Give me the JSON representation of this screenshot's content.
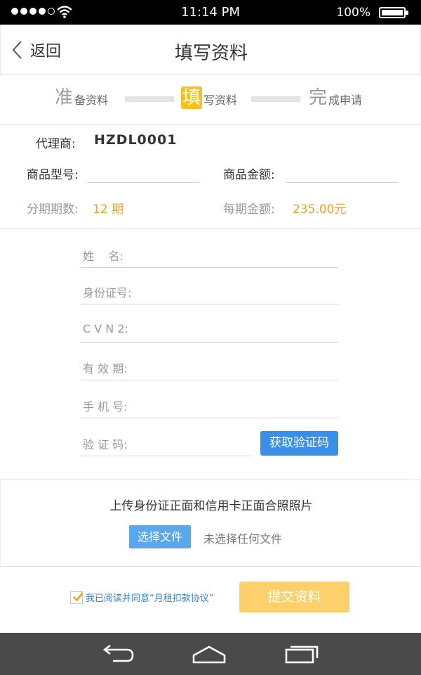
{
  "status_bar": {
    "time": "11:14 PM",
    "battery": "100%",
    "icons": [
      "signal-dots",
      "wifi-icon",
      "battery-icon"
    ]
  },
  "header": {
    "back_label": "返回",
    "title": "填写资料"
  },
  "steps": [
    {
      "big": "准",
      "small": "备资料",
      "active": false
    },
    {
      "big": "填",
      "small": "写资料",
      "active": true
    },
    {
      "big": "完",
      "small": "成申请",
      "active": false
    }
  ],
  "info": {
    "agent_label": "代理商:",
    "agent_value": "HZDL0001",
    "model_label": "商品型号:",
    "model_value": "",
    "amount_label": "商品金额:",
    "amount_value": "",
    "installments_label": "分期期数:",
    "installments_value": "12 期",
    "per_period_label": "每期金额:",
    "per_period_value": "235.00元"
  },
  "form": {
    "name_label": "姓    名:",
    "id_label": "身份证号:",
    "cvn_label": "C V N 2:",
    "expiry_label": "有 效 期:",
    "phone_label": "手 机 号:",
    "code_label": "验 证 码:",
    "get_code_button": "获取验证码"
  },
  "upload": {
    "title": "上传身份证正面和信用卡正面合照照片",
    "choose_button": "选择文件",
    "no_file_text": "未选择任何文件"
  },
  "agreement": {
    "checked": true,
    "text": "我已阅读并同意“月租扣款协议”"
  },
  "submit_button": "提交资料",
  "colors": {
    "accent_orange": "#f0a316",
    "step_active": "#f5c31a",
    "blue_button": "#3a8fe8",
    "choose_button": "#5aa7ee",
    "submit_button": "#fdd06b",
    "link_blue": "#2e86d8"
  }
}
